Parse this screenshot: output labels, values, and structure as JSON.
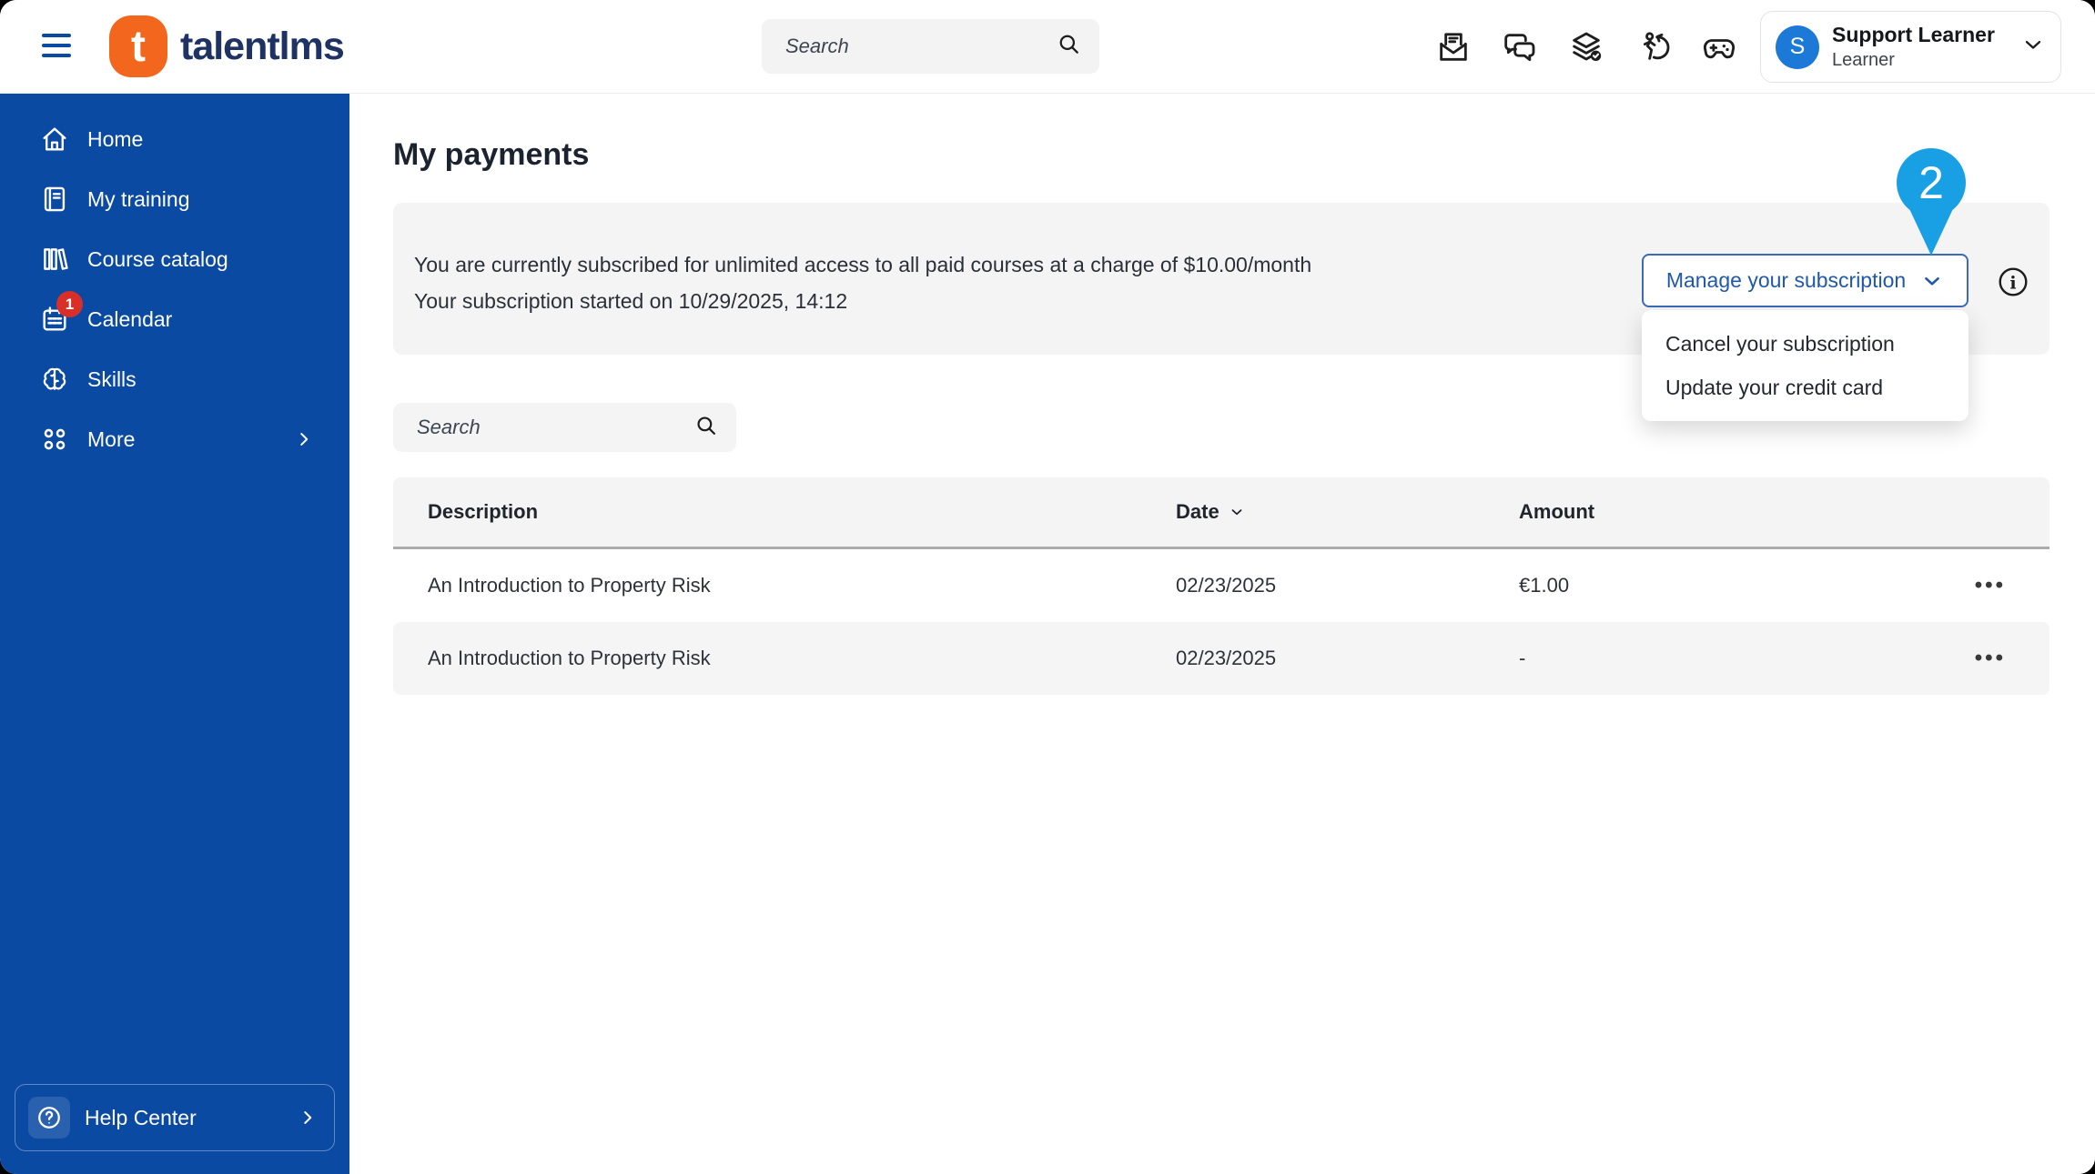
{
  "colors": {
    "sidebar_blue": "#0b4aa3",
    "brand_orange": "#f2671d",
    "brand_navy": "#1e3264",
    "accent_blue": "#2058aa",
    "pin_blue": "#19a0e4",
    "badge_red": "#d83028",
    "avatar_blue": "#1d79d8"
  },
  "topbar": {
    "logo_letter": "t",
    "logo_text": "talentlms",
    "search_placeholder": "Search",
    "user": {
      "name": "Support Learner",
      "role": "Learner",
      "initial": "S"
    }
  },
  "sidebar": {
    "items": [
      {
        "label": "Home"
      },
      {
        "label": "My training"
      },
      {
        "label": "Course catalog"
      },
      {
        "label": "Calendar",
        "badge": "1"
      },
      {
        "label": "Skills"
      },
      {
        "label": "More"
      }
    ],
    "help_label": "Help Center"
  },
  "main": {
    "title": "My payments",
    "subscription": {
      "line1": "You are currently subscribed for unlimited access to all paid courses at a charge of $10.00/month",
      "line2": "Your subscription started on 10/29/2025, 14:12",
      "manage_button": "Manage your subscription",
      "menu": [
        "Cancel your subscription",
        "Update your credit card"
      ],
      "annotation": "2"
    },
    "search_placeholder": "Search",
    "table": {
      "headers": {
        "description": "Description",
        "date": "Date",
        "amount": "Amount"
      },
      "rows": [
        {
          "description": "An Introduction to Property Risk",
          "date": "02/23/2025",
          "amount": "€1.00"
        },
        {
          "description": "An Introduction to Property Risk",
          "date": "02/23/2025",
          "amount": "-"
        }
      ],
      "row_menu_glyph": "•••"
    }
  }
}
